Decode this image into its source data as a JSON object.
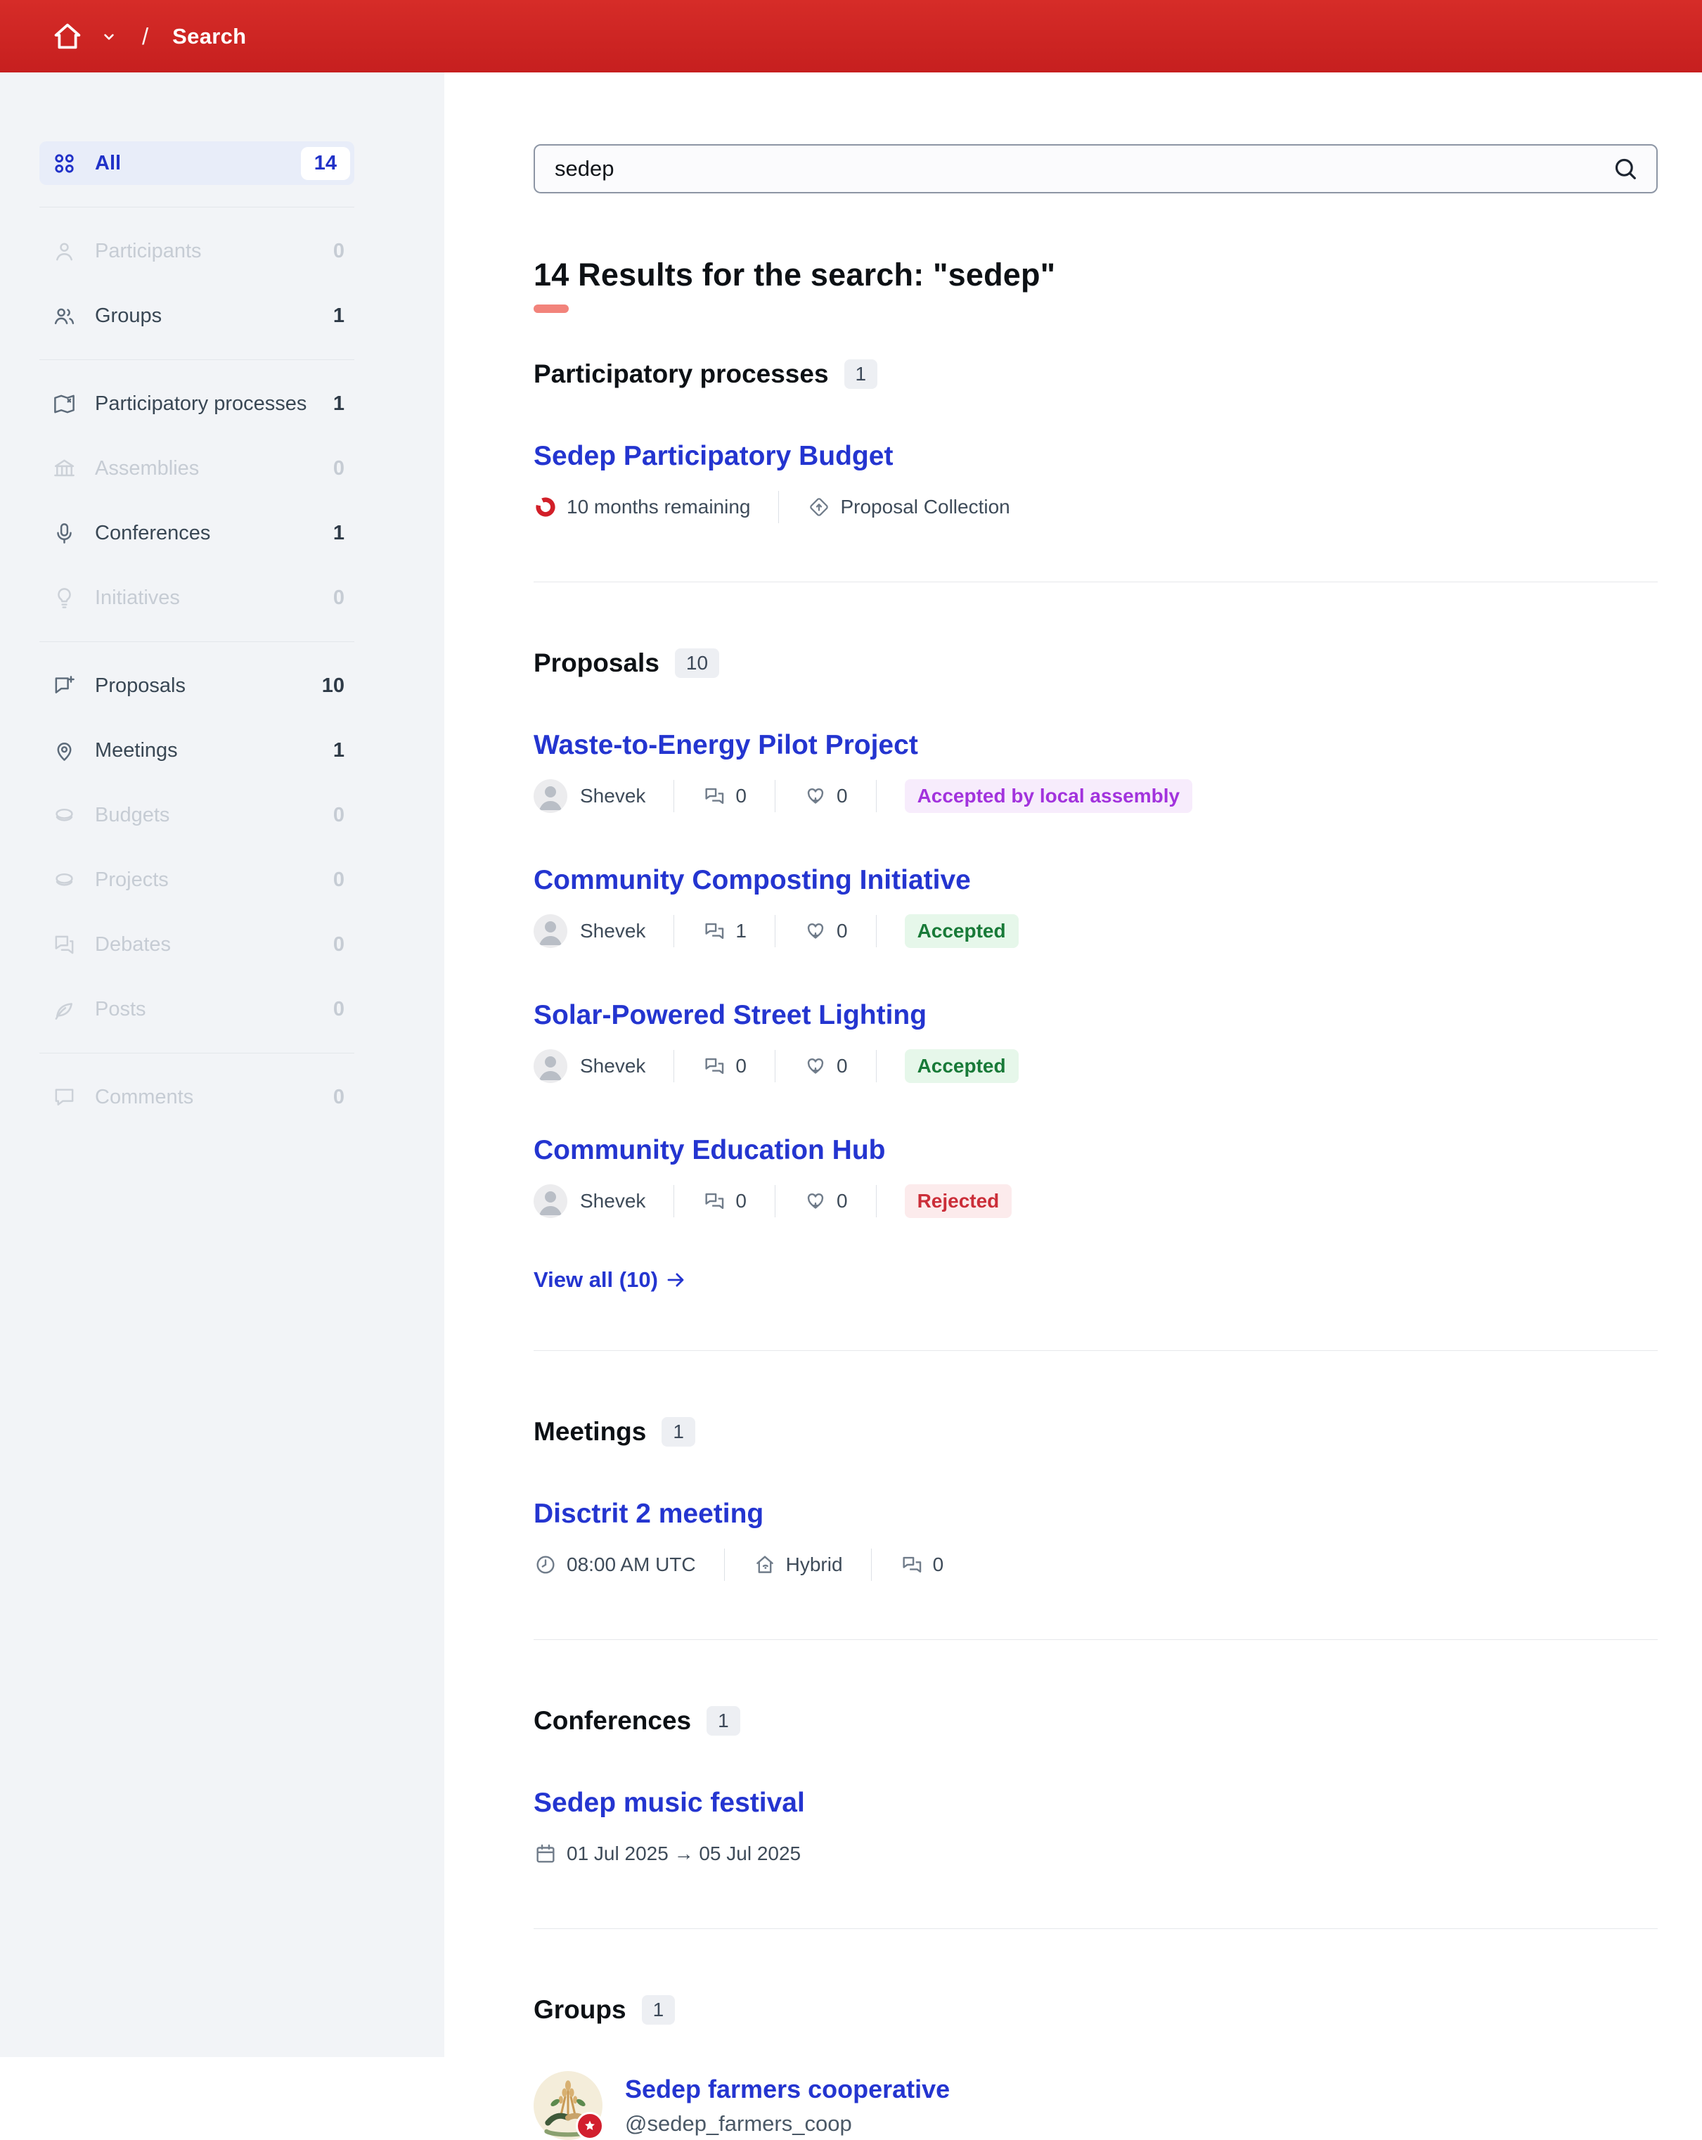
{
  "header": {
    "title": "Search"
  },
  "sidebar": {
    "items": [
      {
        "label": "All",
        "count": "14"
      },
      {
        "label": "Participants",
        "count": "0"
      },
      {
        "label": "Groups",
        "count": "1"
      },
      {
        "label": "Participatory processes",
        "count": "1"
      },
      {
        "label": "Assemblies",
        "count": "0"
      },
      {
        "label": "Conferences",
        "count": "1"
      },
      {
        "label": "Initiatives",
        "count": "0"
      },
      {
        "label": "Proposals",
        "count": "10"
      },
      {
        "label": "Meetings",
        "count": "1"
      },
      {
        "label": "Budgets",
        "count": "0"
      },
      {
        "label": "Projects",
        "count": "0"
      },
      {
        "label": "Debates",
        "count": "0"
      },
      {
        "label": "Posts",
        "count": "0"
      },
      {
        "label": "Comments",
        "count": "0"
      }
    ]
  },
  "search": {
    "value": "sedep"
  },
  "results": {
    "heading": "14 Results for the search: \"sedep\""
  },
  "processes": {
    "title": "Participatory processes",
    "count": "1",
    "item": {
      "title": "Sedep Participatory Budget",
      "remaining": "10 months remaining",
      "type": "Proposal Collection"
    }
  },
  "proposals": {
    "title": "Proposals",
    "count": "10",
    "view_all": "View all (10)",
    "items": [
      {
        "title": "Waste-to-Energy Pilot Project",
        "author": "Shevek",
        "comments": "0",
        "endorsements": "0",
        "badge": "Accepted by local assembly"
      },
      {
        "title": "Community Composting Initiative",
        "author": "Shevek",
        "comments": "1",
        "endorsements": "0",
        "badge": "Accepted"
      },
      {
        "title": "Solar-Powered Street Lighting",
        "author": "Shevek",
        "comments": "0",
        "endorsements": "0",
        "badge": "Accepted"
      },
      {
        "title": "Community Education Hub",
        "author": "Shevek",
        "comments": "0",
        "endorsements": "0",
        "badge": "Rejected"
      }
    ]
  },
  "meetings": {
    "title": "Meetings",
    "count": "1",
    "item": {
      "title": "Disctrit 2 meeting",
      "time": "08:00 AM UTC",
      "mode": "Hybrid",
      "comments": "0"
    }
  },
  "conferences": {
    "title": "Conferences",
    "count": "1",
    "item": {
      "title": "Sedep music festival",
      "dates": "01 Jul 2025 → 05 Jul 2025"
    }
  },
  "groups": {
    "title": "Groups",
    "count": "1",
    "item": {
      "name": "Sedep farmers cooperative",
      "handle": "@sedep_farmers_coop"
    }
  },
  "colors": {
    "header_red": "#cd2126",
    "accent_blue": "#2435d0",
    "selected_row_bg": "#e8edf9",
    "badge_purple": "#a233dd",
    "badge_green": "#187a38",
    "badge_red": "#cb2e39",
    "heading_underline": "#f2837b"
  }
}
